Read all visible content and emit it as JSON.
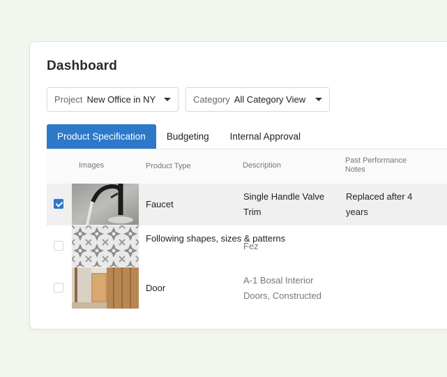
{
  "title": "Dashboard",
  "filters": {
    "project": {
      "label": "Project",
      "value": "New Office in NY"
    },
    "category": {
      "label": "Category",
      "value": "All Category View"
    }
  },
  "tabs": [
    {
      "label": "Product Specification",
      "active": true
    },
    {
      "label": "Budgeting",
      "active": false
    },
    {
      "label": "Internal Approval",
      "active": false
    }
  ],
  "table": {
    "headers": [
      "Images",
      "Product Type",
      "Description",
      "Past Performance Notes"
    ],
    "rows": [
      {
        "checked": true,
        "image": "faucet",
        "product_type": "Faucet",
        "description": "Single Handle Valve Trim",
        "notes": "Replaced after 4 years"
      },
      {
        "checked": false,
        "image": "tile-pattern",
        "product_type": "Following shapes, sizes & patterns",
        "description": "Fez",
        "notes": ""
      },
      {
        "checked": false,
        "image": "door",
        "product_type": "Door",
        "description": "A-1 Bosal Interior Doors, Constructed",
        "notes": ""
      }
    ]
  },
  "colors": {
    "accent": "#2c78c9",
    "background": "#f1f7ee"
  }
}
